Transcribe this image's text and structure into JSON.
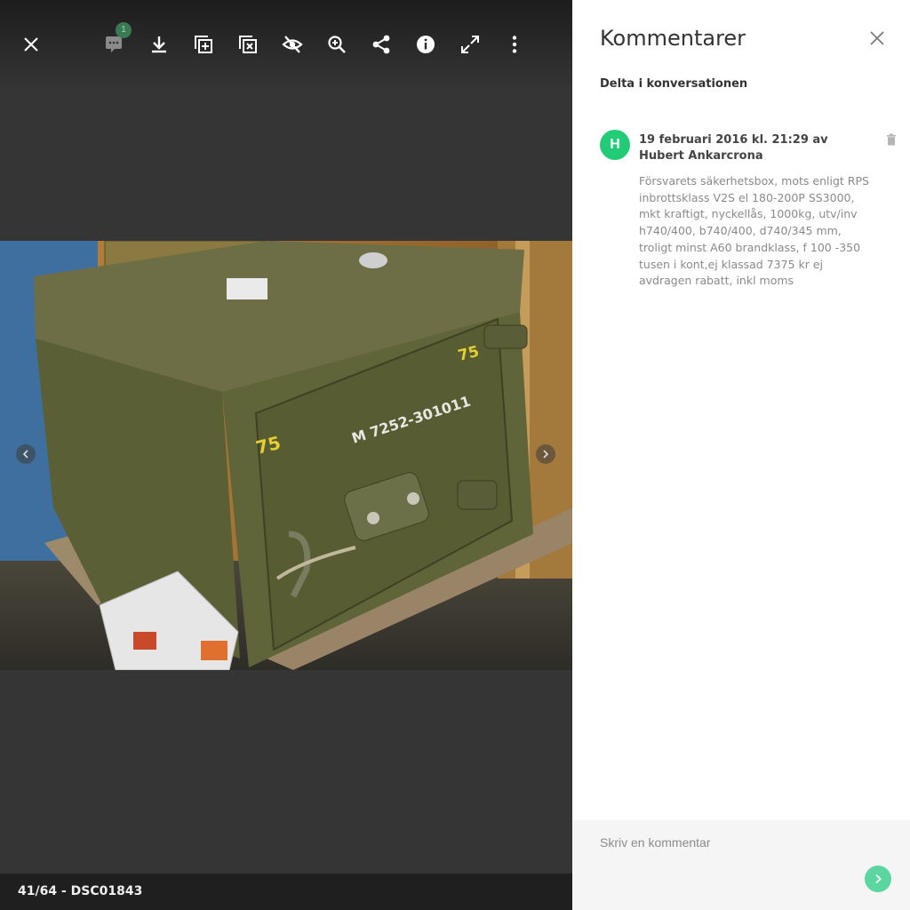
{
  "viewer": {
    "toolbar": {
      "close": "close-icon",
      "comments": {
        "icon": "comment-icon",
        "count": "1"
      },
      "buttons": [
        "download-icon",
        "add-to-album-icon",
        "remove-from-album-icon",
        "hide-icon",
        "zoom-in-icon",
        "share-icon",
        "info-icon",
        "fullscreen-icon",
        "more-icon"
      ]
    },
    "photo_counter": "41/64 - DSC01843",
    "photo_stencils": {
      "number_left": "75",
      "number_right": "75",
      "serial": "M 7252-301011"
    }
  },
  "panel": {
    "title": "Kommentarer",
    "join": "Delta i konversationen",
    "comments": [
      {
        "avatar_initial": "H",
        "avatar_color": "#22cc77",
        "meta": "19 februari 2016 kl. 21:29 av Hubert Ankarcrona",
        "text": "Försvarets säkerhetsbox, mots enligt RPS inbrottsklass V2S el 180-200P SS3000, mkt kraftigt, nyckellås, 1000kg, utv/inv h740/400, b740/400, d740/345 mm, troligt minst A60 brandklass, f 100 -350 tusen i kont,ej klassad 7375 kr ej avdragen rabatt, inkl moms"
      }
    ],
    "input": {
      "placeholder": "Skriv en kommentar",
      "value": ""
    },
    "send": "send-icon"
  },
  "colors": {
    "accent": "#22cc77",
    "send": "#5cd6a0",
    "viewer_bg": "#353535"
  }
}
